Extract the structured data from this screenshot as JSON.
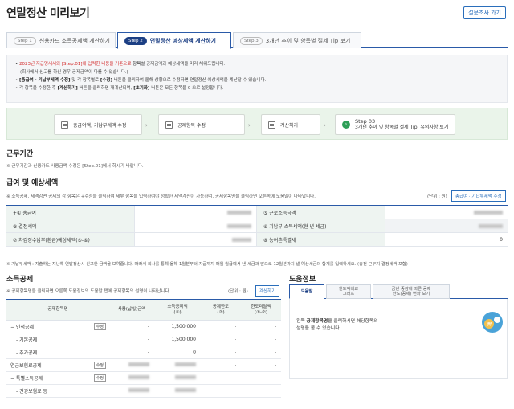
{
  "header": {
    "title": "연말정산 미리보기",
    "survey_button": "설문조사 가기"
  },
  "tabs": [
    {
      "step": "Step 1",
      "label": "신용카드 소득공제액 계산하기"
    },
    {
      "step": "Step 2",
      "label": "연말정산 예상세액 계산하기"
    },
    {
      "step": "Step 3",
      "label": "3개년 추이 및 항목별 절세 Tip 보기"
    }
  ],
  "notes": {
    "line1_red": "2023년 지급명세서와 [Step.01]에 입력한 내용을 기준으로",
    "line1_rest": " 항목별 공제금액과 예상세액을 미리 채워드립니다.",
    "line2": "(회사에서 신고를 하신 경우 공제금액이 다를 수 있습니다.)",
    "line3_bold": "[총급여 · 기납부세액 수정]",
    "line3_mid": " 및 각 항목별로 ",
    "line3_bold2": "[수정]",
    "line3_rest": " 버튼을 클릭하여 올해 상황으로 수정하면 연말정산 예상세액을 계산할 수 있습니다.",
    "line4_pre": "각 항목을 수정한 후 ",
    "line4_b1": "[계산하기]",
    "line4_mid": " 버튼을 클릭하면 재계산되며, ",
    "line4_b2": "[초기화]",
    "line4_rest": " 버튼은 모든 항목을 0 으로 설정합니다."
  },
  "flow": [
    {
      "label": "총급여액, 기납부세액 수정"
    },
    {
      "label": "공제항목 수정"
    },
    {
      "label": "계산하기"
    },
    {
      "label": "Step 03",
      "sub": "3개년 추이 및 항목별 절세 Tip, 유의사항 보기"
    }
  ],
  "work_period": {
    "heading": "근무기간",
    "note": "※ 근무기간과 신용카드 사용금액 수정은 [Step.01]에서 하시기 바랍니다."
  },
  "salary": {
    "heading": "급여 및 예상세액",
    "note": "※ 소득공제, 세액감면 공제의 각 항목은 +수정을 클릭하여 세부 항목을 입력하여야 정확한 세액계산이 가능하며, 공제항목명을 클릭하면 오른쪽에 도움말이 나타납니다.",
    "unit": "(단위 : 원)",
    "edit_button": "총급여 · 기납부세액 수정",
    "rows": [
      [
        "+① 총급여",
        "",
        "⑤ 근로소득금액",
        ""
      ],
      [
        "③ 결정세액",
        "",
        "⑥ 기납부 소득세액(현 년 세금)",
        ""
      ],
      [
        "⑦ 차감징수납부(환급)예상세액(⑤-⑥)",
        "",
        "⑧ 농어촌특별세",
        "0"
      ]
    ],
    "footnote": "※ 기납부세액 : 지출하는 지난해 연말정산시 신고한 금액을 보여줍니다. 따라서 회사를 통해 올해 1월분부터 지급까지 매월 월급에서 낸 세금과 앞으로 12월분까지 낼 예상세금의 합계를 입력하세요. (총전 근무지 결정세액 포함)"
  },
  "income": {
    "heading": "소득공제",
    "note": "※ 공제항목명을 클릭하면 오른쪽 도움정보의 도움말 탭에 공제항목의 설명이 나타납니다.",
    "unit": "(단위 : 원)",
    "calc_button": "계산하기",
    "headers": [
      "공제항목명",
      "사용(납입)금액",
      "소득공제액\n(①)",
      "공제한도\n(②)",
      "한도미달액\n(①-②)"
    ],
    "rows": [
      {
        "name": "− 인적공제",
        "edit": "수정",
        "paid": "-",
        "deduct": "1,500,000",
        "limit": "-",
        "short": "-"
      },
      {
        "name": "- 기본공제",
        "edit": "",
        "paid": "-",
        "deduct": "1,500,000",
        "limit": "-",
        "short": "-"
      },
      {
        "name": "- 추가공제",
        "edit": "",
        "paid": "-",
        "deduct": "0",
        "limit": "-",
        "short": "-"
      },
      {
        "name": "연금보험료공제",
        "edit": "수정",
        "paid": "",
        "deduct": "",
        "limit": "-",
        "short": "-"
      },
      {
        "name": "− 특별소득공제",
        "edit": "수정",
        "paid": "",
        "deduct": "",
        "limit": "-",
        "short": "-"
      },
      {
        "name": "- 건강보험료 등",
        "edit": "",
        "paid": "",
        "deduct": "",
        "limit": "-",
        "short": "-"
      }
    ]
  },
  "help": {
    "heading": "도움정보",
    "tabs": [
      "도움말",
      "한도액비교\n그래프",
      "금년 증감에 따른 공제\n한도(공제) 변화 보기"
    ],
    "text_pre": "왼쪽 ",
    "text_bold": "공제항목명",
    "text_rest": "을 클릭하시면 해당항목의\n설명을 볼 수 있습니다."
  }
}
